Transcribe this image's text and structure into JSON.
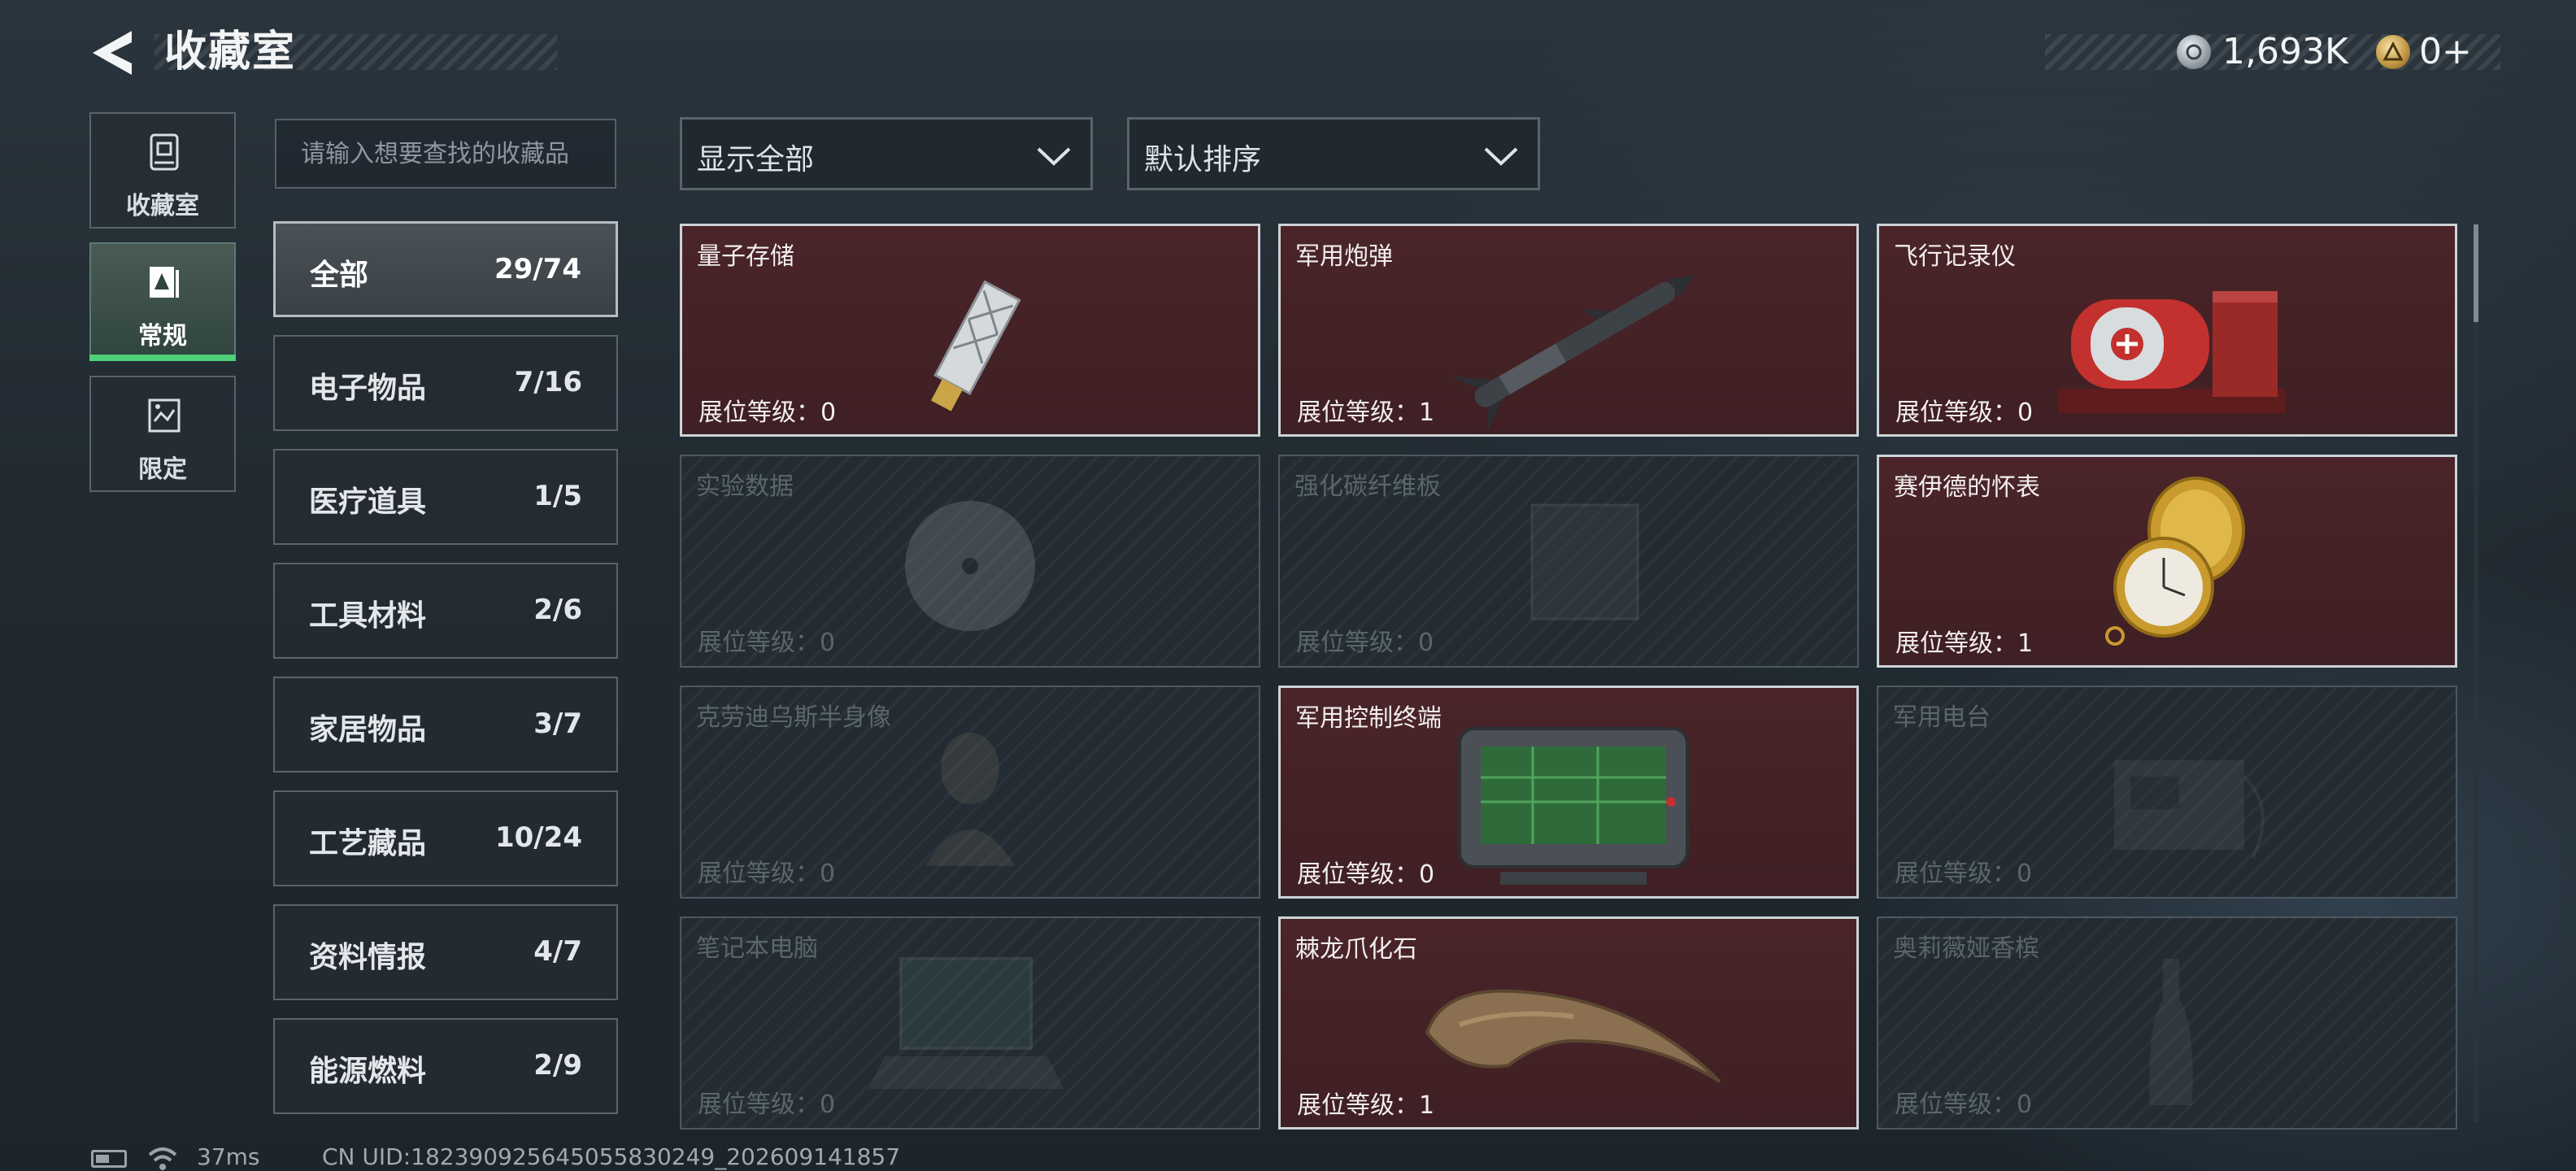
{
  "header": {
    "title": "收藏室",
    "currency": [
      {
        "icon": "silver-coin-icon",
        "value": "1,693K"
      },
      {
        "icon": "gold-coin-icon",
        "value": "0+"
      }
    ]
  },
  "nav": [
    {
      "label": "收藏室",
      "icon": "collection-room-icon",
      "active": false
    },
    {
      "label": "常规",
      "icon": "regular-icon",
      "active": true
    },
    {
      "label": "限定",
      "icon": "limited-icon",
      "active": false
    }
  ],
  "search": {
    "placeholder": "请输入想要查找的收藏品",
    "value": ""
  },
  "categories": [
    {
      "label": "全部",
      "count": "29/74",
      "active": true
    },
    {
      "label": "电子物品",
      "count": "7/16"
    },
    {
      "label": "医疗道具",
      "count": "1/5"
    },
    {
      "label": "工具材料",
      "count": "2/6"
    },
    {
      "label": "家居物品",
      "count": "3/7"
    },
    {
      "label": "工艺藏品",
      "count": "10/24"
    },
    {
      "label": "资料情报",
      "count": "4/7"
    },
    {
      "label": "能源燃料",
      "count": "2/9"
    }
  ],
  "filters": {
    "display": {
      "label": "显示全部",
      "icon": "chevron-down-icon"
    },
    "sort": {
      "label": "默认排序",
      "icon": "chevron-down-icon"
    }
  },
  "items": [
    {
      "name": "量子存储",
      "level": "展位等级：0",
      "owned": true,
      "icon": "usb-drive-icon"
    },
    {
      "name": "军用炮弹",
      "level": "展位等级：1",
      "owned": true,
      "icon": "missile-icon"
    },
    {
      "name": "飞行记录仪",
      "level": "展位等级：0",
      "owned": true,
      "icon": "flight-recorder-icon"
    },
    {
      "name": "实验数据",
      "level": "展位等级：0",
      "owned": false,
      "icon": "disc-icon"
    },
    {
      "name": "强化碳纤维板",
      "level": "展位等级：0",
      "owned": false,
      "icon": "carbon-plate-icon"
    },
    {
      "name": "赛伊德的怀表",
      "level": "展位等级：1",
      "owned": true,
      "icon": "pocket-watch-icon"
    },
    {
      "name": "克劳迪乌斯半身像",
      "level": "展位等级：0",
      "owned": false,
      "icon": "bust-icon"
    },
    {
      "name": "军用控制终端",
      "level": "展位等级：0",
      "owned": true,
      "icon": "control-terminal-icon"
    },
    {
      "name": "军用电台",
      "level": "展位等级：0",
      "owned": false,
      "icon": "radio-icon"
    },
    {
      "name": "笔记本电脑",
      "level": "展位等级：0",
      "owned": false,
      "icon": "laptop-icon"
    },
    {
      "name": "棘龙爪化石",
      "level": "展位等级：1",
      "owned": true,
      "icon": "claw-fossil-icon"
    },
    {
      "name": "奥莉薇娅香槟",
      "level": "展位等级：0",
      "owned": false,
      "icon": "champagne-icon"
    }
  ],
  "footer": {
    "ping": "37ms",
    "uid": "CN UID:18239092564505583024​9_202609141857"
  },
  "colors": {
    "owned_card_bg": "#45222a",
    "active_tab_accent": "#4fd07a",
    "background": "#232c33"
  }
}
